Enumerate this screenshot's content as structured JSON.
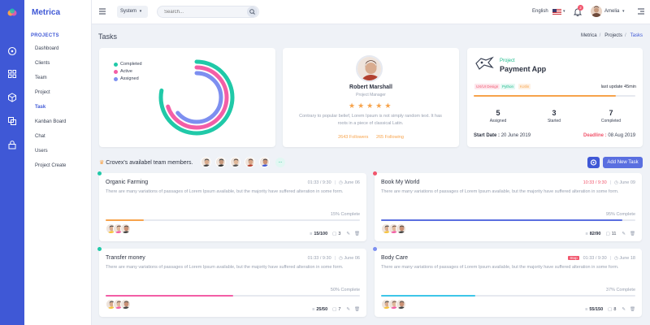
{
  "app": {
    "brand": "Metrica"
  },
  "sidebar": {
    "heading": "PROJECTS",
    "items": [
      {
        "label": "Dashboard"
      },
      {
        "label": "Clients"
      },
      {
        "label": "Team"
      },
      {
        "label": "Project"
      },
      {
        "label": "Task",
        "active": true
      },
      {
        "label": "Kanban Board"
      },
      {
        "label": "Chat"
      },
      {
        "label": "Users"
      },
      {
        "label": "Project Create"
      }
    ]
  },
  "topbar": {
    "system_label": "System",
    "search_placeholder": "Search...",
    "language": "English",
    "notifications_count": "2",
    "user_name": "Amelia"
  },
  "page": {
    "title": "Tasks",
    "breadcrumb": [
      "Metrica",
      "Projects",
      "Tasks"
    ]
  },
  "chart_data": {
    "type": "radial_bar",
    "series": [
      {
        "name": "Completed",
        "color": "#20c9a8",
        "value": 78
      },
      {
        "name": "Active",
        "color": "#f35ea6",
        "value": 70
      },
      {
        "name": "Assigned",
        "color": "#7d8ff0",
        "value": 64
      }
    ]
  },
  "profile": {
    "name": "Robert Marshall",
    "role": "Project Manager",
    "rating": 5,
    "quote": "Contrary to popular belief, Lorem Ipsum is not simply random text. It has roots in a piece of classical Latin.",
    "followers": "2643 Followers",
    "following": "265 Following"
  },
  "project": {
    "label": "Project",
    "title": "Payment App",
    "tags": [
      "UX/UI Design",
      "Python",
      "Kotlin"
    ],
    "last_update": "last update 45min",
    "progress": 0.88,
    "stats": [
      {
        "value": "5",
        "label": "Assigned"
      },
      {
        "value": "3",
        "label": "Started"
      },
      {
        "value": "7",
        "label": "Completed"
      }
    ],
    "start_label": "Start Date :",
    "start_date": "20 June 2019",
    "deadline_label": "Deadline :",
    "deadline_date": "08 Aug 2019"
  },
  "team": {
    "text": "Crovex's availabel team members.",
    "more": "..."
  },
  "actions": {
    "add_task": "Add New Task"
  },
  "tasks": [
    {
      "title": "Organic Farming",
      "time": "01:33 / 9:30",
      "date": "June 06",
      "desc": "There are many variations of passages of Lorem Ipsum available, but the majority have suffered alteration in some form.",
      "percent": "15% Complete",
      "progress": 0.15,
      "bar_color": "#f7a34b",
      "dot_color": "#20c9a8",
      "tasks_count": "15/100",
      "comments": "3"
    },
    {
      "title": "Book My World",
      "time": "10:33 / 9:30",
      "date": "June 09",
      "desc": "There are many variations of passages of Lorem Ipsum available, but the majority have suffered alteration in some form.",
      "percent": "95% Complete",
      "progress": 0.95,
      "bar_color": "#5a6fe0",
      "dot_color": "#f1556c",
      "tasks_count": "82/90",
      "comments": "11",
      "overdue": true
    },
    {
      "title": "Transfer money",
      "time": "01:33 / 9:30",
      "date": "June 06",
      "desc": "There are many variations of passages of Lorem Ipsum available, but the majority have suffered alteration in some form.",
      "percent": "50% Complete",
      "progress": 0.5,
      "bar_color": "#f35ea6",
      "dot_color": "#20c9a8",
      "tasks_count": "25/50",
      "comments": "7"
    },
    {
      "title": "Body Care",
      "time": "01:33 / 9:30",
      "date": "June 18",
      "desc": "There are many variations of passages of Lorem Ipsum available, but the majority have suffered alteration in some form.",
      "percent": "37% Complete",
      "progress": 0.37,
      "bar_color": "#3ec6e8",
      "dot_color": "#7d8ff0",
      "tasks_count": "55/150",
      "comments": "8",
      "badge": "Stop"
    }
  ]
}
